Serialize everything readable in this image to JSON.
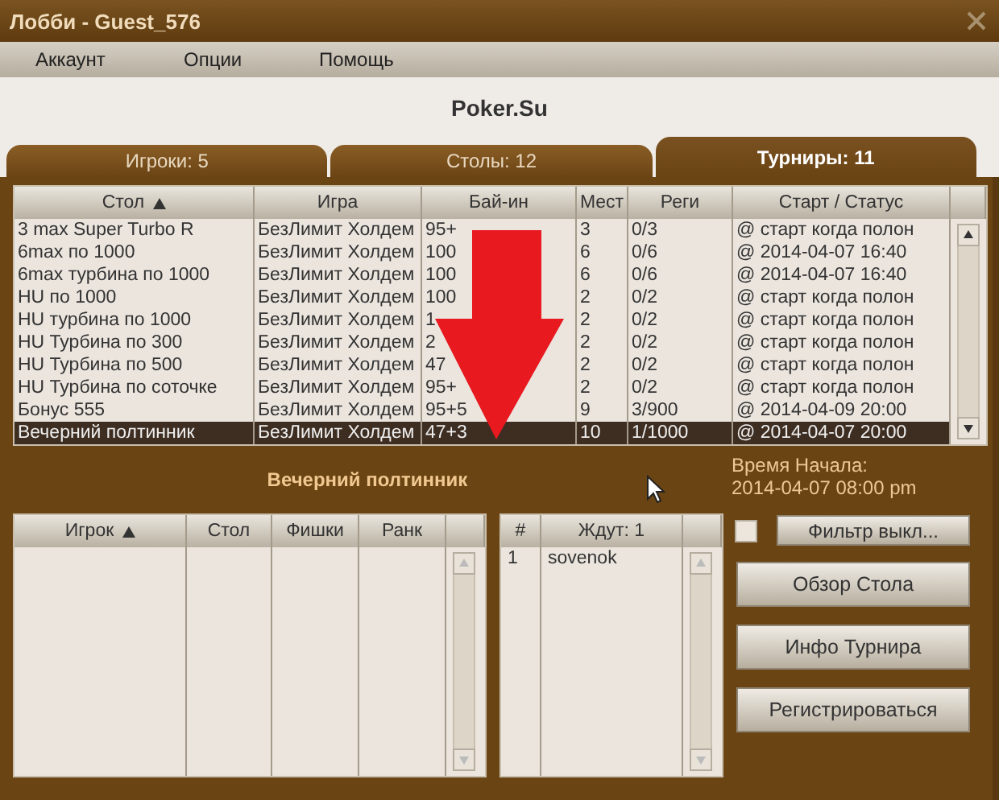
{
  "window": {
    "title": "Лобби - Guest_576"
  },
  "menu": [
    "Аккаунт",
    "Опции",
    "Помощь"
  ],
  "brand": "Poker.Su",
  "tabs": [
    {
      "label": "Игроки: 5",
      "selected": false
    },
    {
      "label": "Столы: 12",
      "selected": false
    },
    {
      "label": "Турниры: 11",
      "selected": true
    }
  ],
  "tournaments": {
    "columns": [
      {
        "label": "Стол",
        "sorted": true
      },
      {
        "label": "Игра",
        "sorted": false
      },
      {
        "label": "Бай-ин",
        "sorted": false
      },
      {
        "label": "Мест",
        "sorted": false
      },
      {
        "label": "Реги",
        "sorted": false
      },
      {
        "label": "Старт / Статус",
        "sorted": false
      }
    ],
    "rows": [
      {
        "cells": [
          "3 max Super Turbo R",
          "БезЛимит Холдем",
          "95+",
          "3",
          "0/3",
          "@ старт когда полон"
        ],
        "selected": false
      },
      {
        "cells": [
          "6max по 1000",
          "БезЛимит Холдем",
          "100",
          "6",
          "0/6",
          "@ 2014-04-07 16:40"
        ],
        "selected": false
      },
      {
        "cells": [
          "6max турбина по 1000",
          "БезЛимит Холдем",
          "100",
          "6",
          "0/6",
          "@ 2014-04-07 16:40"
        ],
        "selected": false
      },
      {
        "cells": [
          "HU по 1000",
          "БезЛимит Холдем",
          "100",
          "2",
          "0/2",
          "@ старт когда полон"
        ],
        "selected": false
      },
      {
        "cells": [
          "HU турбина по 1000",
          "БезЛимит Холдем",
          "1",
          "2",
          "0/2",
          "@ старт когда полон"
        ],
        "selected": false
      },
      {
        "cells": [
          "HU Турбина по 300",
          "БезЛимит Холдем",
          "2",
          "2",
          "0/2",
          "@ старт когда полон"
        ],
        "selected": false
      },
      {
        "cells": [
          "HU Турбина по 500",
          "БезЛимит Холдем",
          "47",
          "2",
          "0/2",
          "@ старт когда полон"
        ],
        "selected": false
      },
      {
        "cells": [
          "HU Турбина по соточке",
          "БезЛимит Холдем",
          "95+",
          "2",
          "0/2",
          "@ старт когда полон"
        ],
        "selected": false
      },
      {
        "cells": [
          "Бонус 555",
          "БезЛимит Холдем",
          "95+5",
          "9",
          "3/900",
          "@ 2014-04-09 20:00"
        ],
        "selected": false
      },
      {
        "cells": [
          "Вечерний полтинник",
          "БезЛимит Холдем",
          "47+3",
          "10",
          "1/1000",
          "@ 2014-04-07 20:00"
        ],
        "selected": true
      }
    ]
  },
  "details": {
    "title": "Вечерний полтинник",
    "players": {
      "columns": [
        {
          "label": "Игрок",
          "sorted": true
        },
        {
          "label": "Стол",
          "sorted": false
        },
        {
          "label": "Фишки",
          "sorted": false
        },
        {
          "label": "Ранк",
          "sorted": false
        }
      ]
    },
    "waiting": {
      "columns": [
        {
          "label": "#",
          "sorted": false
        },
        {
          "label": "Ждут: 1",
          "sorted": false
        }
      ],
      "rows": [
        [
          "1",
          "sovenok"
        ]
      ]
    },
    "start_label": "Время Начала:",
    "start_value": "2014-04-07 08:00 pm",
    "filter": {
      "checked": false,
      "label": "Фильтр выкл..."
    },
    "buttons": [
      "Обзор Стола",
      "Инфо Турнира",
      "Регистрироваться"
    ]
  }
}
